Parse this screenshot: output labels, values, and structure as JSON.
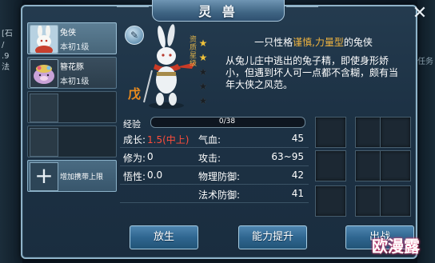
{
  "window": {
    "title": "灵 兽",
    "close_label": "✕"
  },
  "background": {
    "left_text": "[石\n/\n.9\n法",
    "right_text": "任务"
  },
  "pets": [
    {
      "name": "兔侠",
      "level": "本初1级",
      "selected": true
    },
    {
      "name": "簪花豚",
      "level": "本初1级",
      "selected": false
    }
  ],
  "empty_slots": 2,
  "add_slot": {
    "label": "增加携带上限",
    "icon": "plus-icon"
  },
  "portrait": {
    "type_glyph": "戊",
    "star_label": "资质星级",
    "stars_on": 2,
    "stars_total": 5,
    "edit_icon": "pencil-icon"
  },
  "description": {
    "title_prefix": "一只性格",
    "title_highlight": "谨慎,力量型",
    "title_suffix": "的兔侠",
    "body": "从兔儿庄中逃出的兔子精，即使身形娇小，但遇到坏人可一点都不含糊，颇有当年大侠之风范。"
  },
  "exp": {
    "label": "经验",
    "text": "0/38",
    "current": 0,
    "max": 38
  },
  "stats": [
    {
      "k1": "成长:",
      "v1": "1.5(中上)",
      "v1_highlight": true,
      "k2": "气血:",
      "v2": "45"
    },
    {
      "k1": "修为:",
      "v1": "0",
      "v1_highlight": false,
      "k2": "攻击:",
      "v2": "63~95"
    },
    {
      "k1": "悟性:",
      "v1": "0.0",
      "v1_highlight": false,
      "k2": "物理防御:",
      "v2": "42"
    },
    {
      "k1": "",
      "v1": "",
      "v1_highlight": false,
      "k2": "法术防御:",
      "v2": "41"
    }
  ],
  "buttons": {
    "release": "放生",
    "upgrade": "能力提升",
    "deploy": "出战"
  },
  "watermark": "欧漫露",
  "colors": {
    "highlight": "#f0b440",
    "growth_red": "#ff4d3b",
    "type_orange": "#e88a1e",
    "star_gold": "#f0c23a"
  }
}
